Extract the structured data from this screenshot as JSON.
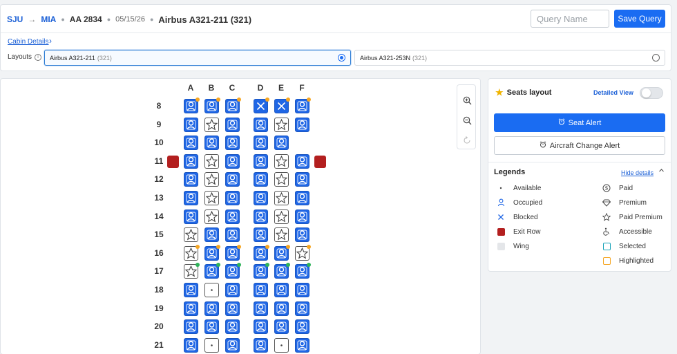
{
  "header": {
    "origin": "SJU",
    "destination": "MIA",
    "flight": "AA 2834",
    "date": "05/15/26",
    "aircraft": "Airbus A321-211 (321)",
    "query_placeholder": "Query Name",
    "save_label": "Save Query"
  },
  "cabin": {
    "link_label": "Cabin Details"
  },
  "layouts": {
    "label": "Layouts",
    "options": [
      {
        "name": "Airbus A321-211",
        "code": "(321)",
        "selected": true
      },
      {
        "name": "Airbus A321-253N",
        "code": "(321)",
        "selected": false
      }
    ]
  },
  "seatmap": {
    "columns": [
      "A",
      "B",
      "C",
      "D",
      "E",
      "F"
    ],
    "rows": [
      {
        "num": "8",
        "seats": [
          "occ:o",
          "occ:o",
          "occ:o",
          "blk:o",
          "blk:o",
          "occ:o"
        ]
      },
      {
        "num": "9",
        "seats": [
          "occ",
          "prem",
          "occ",
          "occ",
          "prem",
          "occ"
        ]
      },
      {
        "num": "10",
        "seats": [
          "occ",
          "occ",
          "occ",
          "occ",
          "occ",
          ""
        ]
      },
      {
        "num": "11",
        "exit": true,
        "seats": [
          "occ",
          "prem",
          "occ",
          "occ",
          "prem",
          "occ"
        ]
      },
      {
        "num": "12",
        "seats": [
          "occ",
          "prem",
          "occ",
          "occ",
          "prem",
          "occ"
        ]
      },
      {
        "num": "13",
        "seats": [
          "occ",
          "prem",
          "occ",
          "occ",
          "prem",
          "occ"
        ]
      },
      {
        "num": "14",
        "seats": [
          "occ",
          "prem",
          "occ",
          "occ",
          "prem",
          "occ"
        ]
      },
      {
        "num": "15",
        "seats": [
          "prem",
          "occ",
          "occ",
          "occ",
          "prem",
          "occ"
        ]
      },
      {
        "num": "16",
        "seats": [
          "prem:o",
          "occ:o",
          "occ:o",
          "occ:o",
          "occ:o",
          "prem:o"
        ]
      },
      {
        "num": "17",
        "seats": [
          "prem:g",
          "occ:g",
          "occ:g",
          "occ:g",
          "occ:g",
          "occ:g"
        ]
      },
      {
        "num": "18",
        "seats": [
          "occ",
          "avl",
          "occ",
          "occ",
          "occ",
          "occ"
        ]
      },
      {
        "num": "19",
        "seats": [
          "occ",
          "occ",
          "occ",
          "occ",
          "occ",
          "occ"
        ]
      },
      {
        "num": "20",
        "seats": [
          "occ",
          "occ",
          "occ",
          "occ",
          "occ",
          "occ"
        ]
      },
      {
        "num": "21",
        "seats": [
          "occ",
          "avl",
          "occ",
          "occ",
          "avl",
          "occ"
        ]
      }
    ]
  },
  "side": {
    "title": "Seats layout",
    "detailed_view_label": "Detailed View",
    "seat_alert_label": "Seat Alert",
    "aircraft_change_label": "Aircraft Change Alert",
    "legends_title": "Legends",
    "hide_details_label": "Hide details",
    "legends_left": [
      {
        "label": "Available",
        "icon": "dot-icon"
      },
      {
        "label": "Occupied",
        "icon": "person-icon"
      },
      {
        "label": "Blocked",
        "icon": "x-icon"
      },
      {
        "label": "Exit Row",
        "icon": "red-square-icon"
      },
      {
        "label": "Wing",
        "icon": "gray-square-icon"
      }
    ],
    "legends_right": [
      {
        "label": "Paid",
        "icon": "dollar-icon"
      },
      {
        "label": "Premium",
        "icon": "diamond-icon"
      },
      {
        "label": "Paid Premium",
        "icon": "star-icon"
      },
      {
        "label": "Accessible",
        "icon": "accessible-icon"
      },
      {
        "label": "Selected",
        "icon": "teal-square-icon"
      },
      {
        "label": "Highlighted",
        "icon": "orange-square-icon"
      }
    ]
  },
  "colors": {
    "primary": "#1a6cf2",
    "seat_blue": "#1f66e5",
    "exit_red": "#b31f1f",
    "status_orange": "#f5a623",
    "status_green": "#2fb35a"
  }
}
